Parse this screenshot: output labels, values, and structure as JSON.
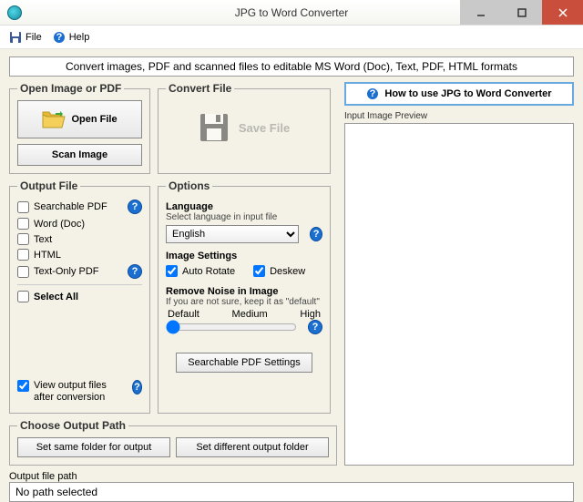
{
  "window": {
    "title": "JPG to Word Converter"
  },
  "menu": {
    "file": "File",
    "help": "Help"
  },
  "banner": "Convert images, PDF and scanned files to editable MS Word (Doc), Text, PDF, HTML formats",
  "open_group": {
    "legend": "Open Image or PDF",
    "open_btn": "Open File",
    "scan_btn": "Scan Image"
  },
  "convert_group": {
    "legend": "Convert File",
    "save_btn": "Save File"
  },
  "output_group": {
    "legend": "Output File",
    "searchable_pdf": "Searchable PDF",
    "word_doc": "Word (Doc)",
    "text": "Text",
    "html": "HTML",
    "text_only_pdf": "Text-Only PDF",
    "select_all": "Select All",
    "view_after": "View output files after conversion"
  },
  "options_group": {
    "legend": "Options",
    "language_label": "Language",
    "language_hint": "Select language in input file",
    "language_value": "English",
    "image_settings_label": "Image Settings",
    "auto_rotate": "Auto Rotate",
    "deskew": "Deskew",
    "remove_noise_label": "Remove Noise in Image",
    "remove_noise_hint": "If you are not sure, keep it as \"default\"",
    "slider_default": "Default",
    "slider_medium": "Medium",
    "slider_high": "High",
    "searchable_pdf_settings": "Searchable PDF Settings"
  },
  "path_group": {
    "legend": "Choose Output Path",
    "same_folder": "Set same folder for output",
    "diff_folder": "Set different output folder"
  },
  "howto_btn": "How to use JPG to Word Converter",
  "preview_label": "Input Image Preview",
  "output_path_label": "Output file path",
  "output_path_value": "No path selected",
  "help_q": "?"
}
